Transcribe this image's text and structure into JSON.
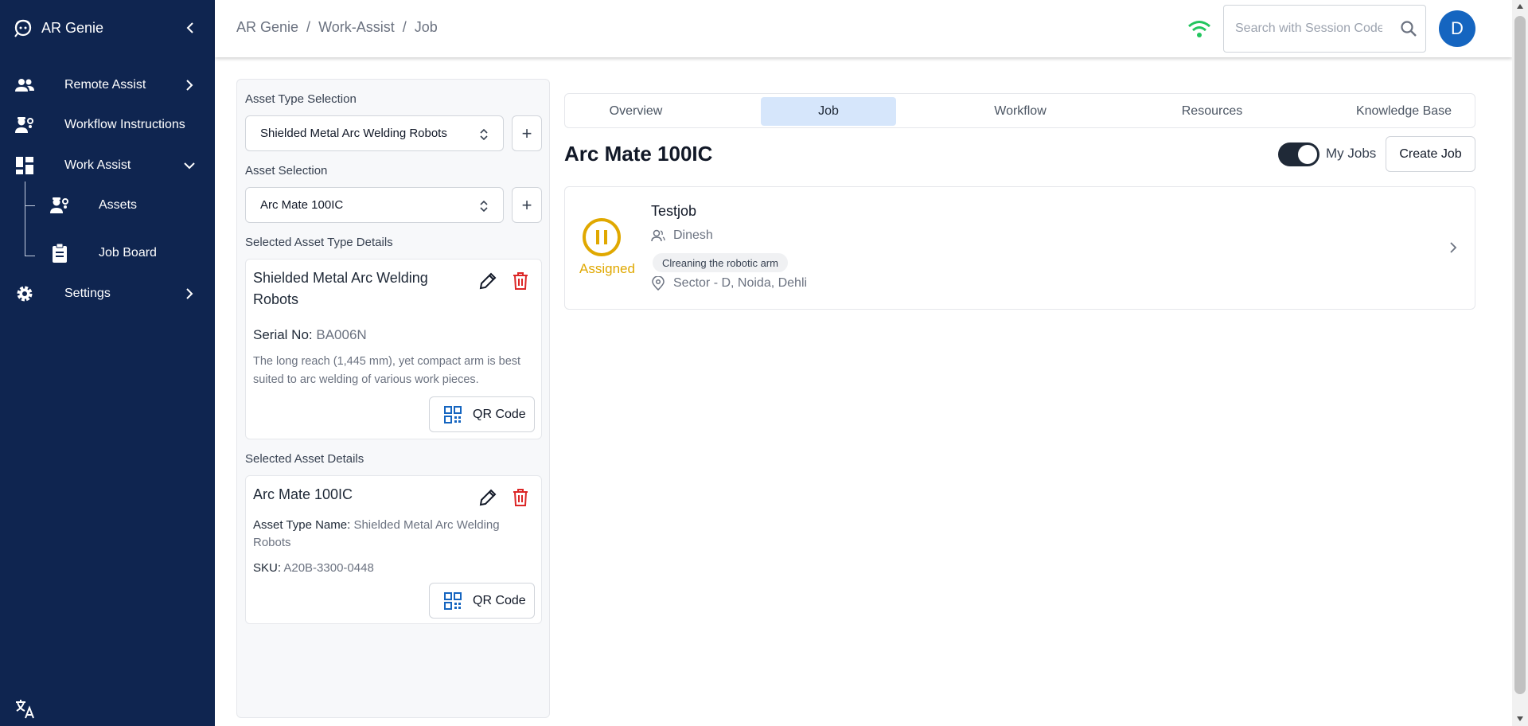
{
  "sidebar": {
    "brand": "AR Genie",
    "items": [
      {
        "label": "Remote Assist"
      },
      {
        "label": "Workflow Instructions"
      },
      {
        "label": "Work Assist"
      },
      {
        "label": "Settings"
      }
    ],
    "sub_items": [
      {
        "label": "Assets"
      },
      {
        "label": "Job Board"
      }
    ]
  },
  "header": {
    "breadcrumb": [
      "AR Genie",
      "/",
      "Work-Assist",
      "/",
      "Job"
    ],
    "search_placeholder": "Search with Session Code",
    "avatar_initial": "D"
  },
  "left_panel": {
    "asset_type_label": "Asset Type Selection",
    "asset_type_value": "Shielded Metal Arc Welding Robots",
    "asset_label": "Asset Selection",
    "asset_value": "Arc Mate 100IC",
    "type_details_label": "Selected Asset Type Details",
    "type_card": {
      "title": "Shielded Metal Arc Welding Robots",
      "serial_label": "Serial No:",
      "serial_value": "BA006N",
      "description": "The long reach (1,445 mm), yet compact arm is best suited to arc welding of various work pieces.",
      "qr_label": "QR Code"
    },
    "asset_details_label": "Selected Asset Details",
    "asset_card": {
      "title": "Arc Mate 100IC",
      "type_name_label": "Asset Type Name:",
      "type_name_value": "Shielded Metal Arc Welding Robots",
      "sku_label": "SKU:",
      "sku_value": "A20B-3300-0448",
      "qr_label": "QR Code"
    }
  },
  "tabs": [
    {
      "label": "Overview"
    },
    {
      "label": "Job"
    },
    {
      "label": "Workflow"
    },
    {
      "label": "Resources"
    },
    {
      "label": "Knowledge Base"
    }
  ],
  "main": {
    "title": "Arc Mate 100IC",
    "my_jobs_label": "My Jobs",
    "my_jobs_enabled": true,
    "create_job_label": "Create Job"
  },
  "job": {
    "status": "Assigned",
    "title": "Testjob",
    "assignee": "Dinesh",
    "tag": "Clreaning the robotic arm",
    "location": "Sector - D, Noida, Dehli"
  },
  "colors": {
    "sidebar_bg": "#0f2550",
    "accent": "#1565c0",
    "status_assigned": "#e0a800",
    "wifi": "#22c55e",
    "delete": "#dc2626",
    "active_tab": "#d6e6fb"
  }
}
